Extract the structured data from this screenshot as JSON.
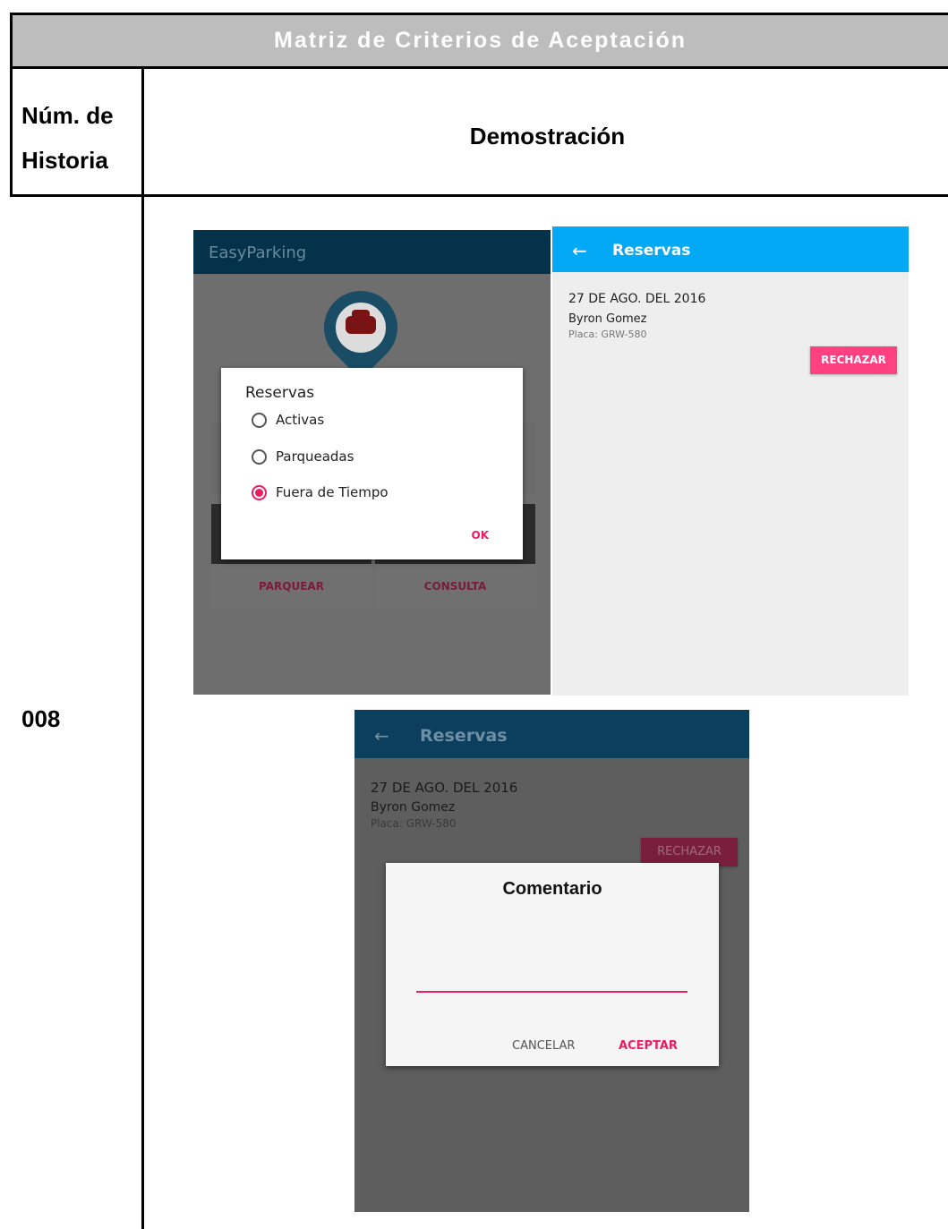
{
  "document": {
    "title": "Matriz de Criterios de Aceptación",
    "col_story_label": "Núm. de Historia",
    "col_demo_label": "Demostración",
    "story_number": "008"
  },
  "screen_menu": {
    "app_title": "EasyParking",
    "dialog_title": "Reservas",
    "options": [
      {
        "label": "Activas",
        "selected": false
      },
      {
        "label": "Parqueadas",
        "selected": false
      },
      {
        "label": "Fuera de Tiempo",
        "selected": true
      }
    ],
    "ok_label": "OK",
    "card_buttons": [
      "PARQUEAR",
      "CONSULTA"
    ]
  },
  "screen_list": {
    "back_icon": "←",
    "title": "Reservas",
    "reservation": {
      "date": "27 DE AGO. DEL 2016",
      "name": "Byron Gomez",
      "plate": "Placa:  GRW-580"
    },
    "reject_label": "RECHAZAR",
    "appbar_color": "#03a9f4",
    "accent_color": "#ff4081"
  },
  "screen_comment": {
    "back_icon": "←",
    "title": "Reservas",
    "reservation": {
      "date": "27 DE AGO. DEL 2016",
      "name": "Byron Gomez",
      "plate": "Placa:  GRW-580"
    },
    "reject_label": "RECHAZAR",
    "dialog_title": "Comentario",
    "comment_value": "",
    "cancel_label": "CANCELAR",
    "accept_label": "ACEPTAR"
  }
}
